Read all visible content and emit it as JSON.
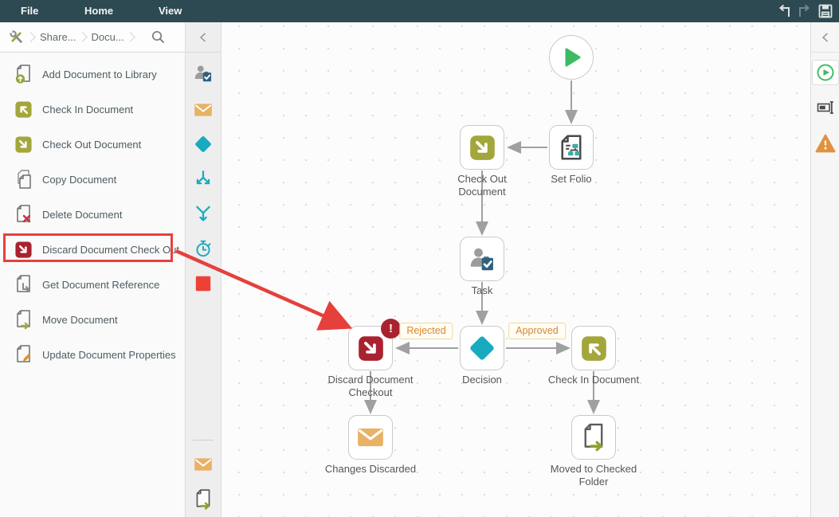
{
  "menubar": {
    "tabs": [
      "File",
      "Home",
      "View"
    ],
    "actions": [
      "undo",
      "redo",
      "save"
    ]
  },
  "breadcrumb": {
    "items": [
      "Share...",
      "Docu..."
    ],
    "icons": [
      "workflow-tools-icon",
      "search-icon"
    ]
  },
  "sidebar": {
    "items": [
      {
        "label": "Add Document to Library",
        "icon": "document-add-icon"
      },
      {
        "label": "Check In Document",
        "icon": "check-in-icon"
      },
      {
        "label": "Check Out Document",
        "icon": "check-out-icon"
      },
      {
        "label": "Copy Document",
        "icon": "document-copy-icon"
      },
      {
        "label": "Delete Document",
        "icon": "document-delete-icon"
      },
      {
        "label": "Discard Document Check Out",
        "icon": "discard-checkout-icon",
        "highlighted": true
      },
      {
        "label": "Get Document Reference",
        "icon": "document-reference-icon"
      },
      {
        "label": "Move Document",
        "icon": "document-move-icon"
      },
      {
        "label": "Update Document Properties",
        "icon": "document-update-icon"
      }
    ]
  },
  "toolbar": {
    "icons": [
      "collapse-icon",
      "user-task-icon",
      "mail-icon",
      "decision-icon",
      "split-icon",
      "merge-icon",
      "timer-icon",
      "end-icon",
      "mail-icon",
      "document-move-icon"
    ]
  },
  "canvas": {
    "nodes": [
      {
        "id": "start",
        "label": "",
        "icon": "start-play-icon"
      },
      {
        "id": "set-folio",
        "label": "Set Folio",
        "icon": "set-folio-icon"
      },
      {
        "id": "check-out-document",
        "label": "Check Out Document",
        "icon": "check-out-icon"
      },
      {
        "id": "task",
        "label": "Task",
        "icon": "user-task-icon"
      },
      {
        "id": "decision",
        "label": "Decision",
        "icon": "decision-icon"
      },
      {
        "id": "discard-document-checkout",
        "label": "Discard Document Checkout",
        "icon": "discard-checkout-icon",
        "badge": "!"
      },
      {
        "id": "check-in-document",
        "label": "Check In Document",
        "icon": "check-in-icon"
      },
      {
        "id": "changes-discarded",
        "label": "Changes Discarded",
        "icon": "mail-icon"
      },
      {
        "id": "moved-to-checked-folder",
        "label": "Moved to Checked Folder",
        "icon": "document-move-icon"
      }
    ],
    "edge_labels": {
      "rejected": "Rejected",
      "approved": "Approved"
    }
  },
  "right_rail": {
    "icons": [
      "collapse-icon",
      "play-icon",
      "rename-icon",
      "warning-icon"
    ]
  },
  "colors": {
    "topbar_bg": "#2d4a52",
    "olive": "#a3a63b",
    "dark_red": "#a8232f",
    "bright_red": "#e6403c",
    "teal": "#18abc0",
    "steel_blue": "#2f617f",
    "envelope_orange": "#e9b164",
    "warning_orange": "#e0923f",
    "play_green": "#3dbb63",
    "edge_label_orange": "#d9862c"
  }
}
